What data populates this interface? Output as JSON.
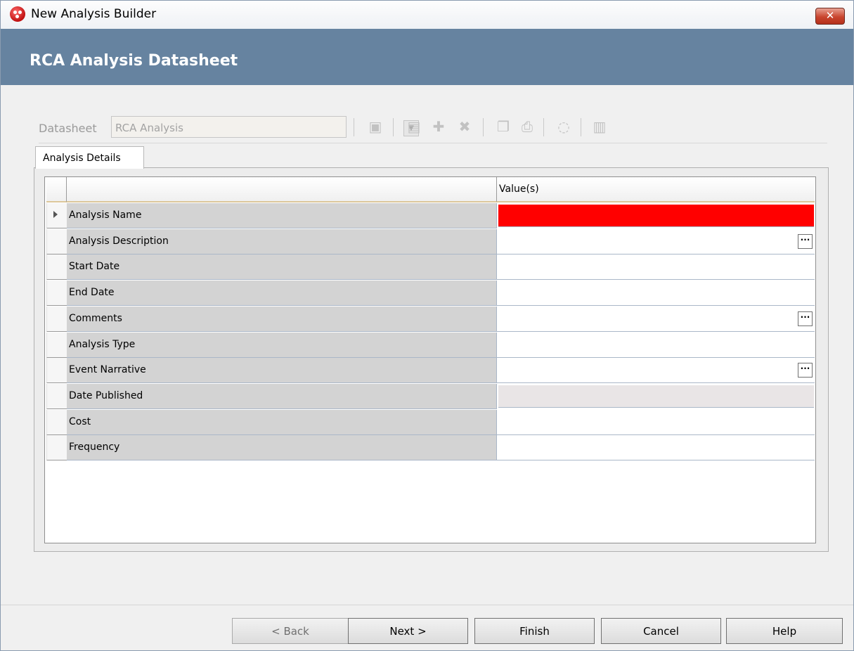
{
  "window": {
    "title": "New Analysis Builder",
    "close_glyph": "✕"
  },
  "banner": {
    "title": "RCA Analysis Datasheet"
  },
  "toolbar": {
    "datasheet_label": "Datasheet",
    "datasheet_value": "RCA Analysis",
    "icons": [
      "open-datasheet-icon",
      "save-icon",
      "save-new-icon",
      "delete-icon",
      "copy-icon",
      "print-icon",
      "refresh-icon",
      "report-icon"
    ]
  },
  "tabs": [
    {
      "label": "Analysis Details"
    }
  ],
  "grid": {
    "value_header": "Value(s)",
    "rows": [
      {
        "label": "Analysis Name",
        "state": "required",
        "current": true
      },
      {
        "label": "Analysis Description",
        "ellipsis": true
      },
      {
        "label": "Start Date"
      },
      {
        "label": "End Date"
      },
      {
        "label": "Comments",
        "ellipsis": true
      },
      {
        "label": "Analysis Type"
      },
      {
        "label": "Event Narrative",
        "ellipsis": true
      },
      {
        "label": "Date Published",
        "state": "disabled"
      },
      {
        "label": "Cost"
      },
      {
        "label": "Frequency"
      }
    ],
    "ellipsis_glyph": "···"
  },
  "buttons": {
    "back": "< Back",
    "next": "Next >",
    "finish": "Finish",
    "cancel": "Cancel",
    "help": "Help"
  },
  "colors": {
    "banner": "#6683a0",
    "required": "#ff0000",
    "disabled_cell": "#e9e5e6"
  }
}
